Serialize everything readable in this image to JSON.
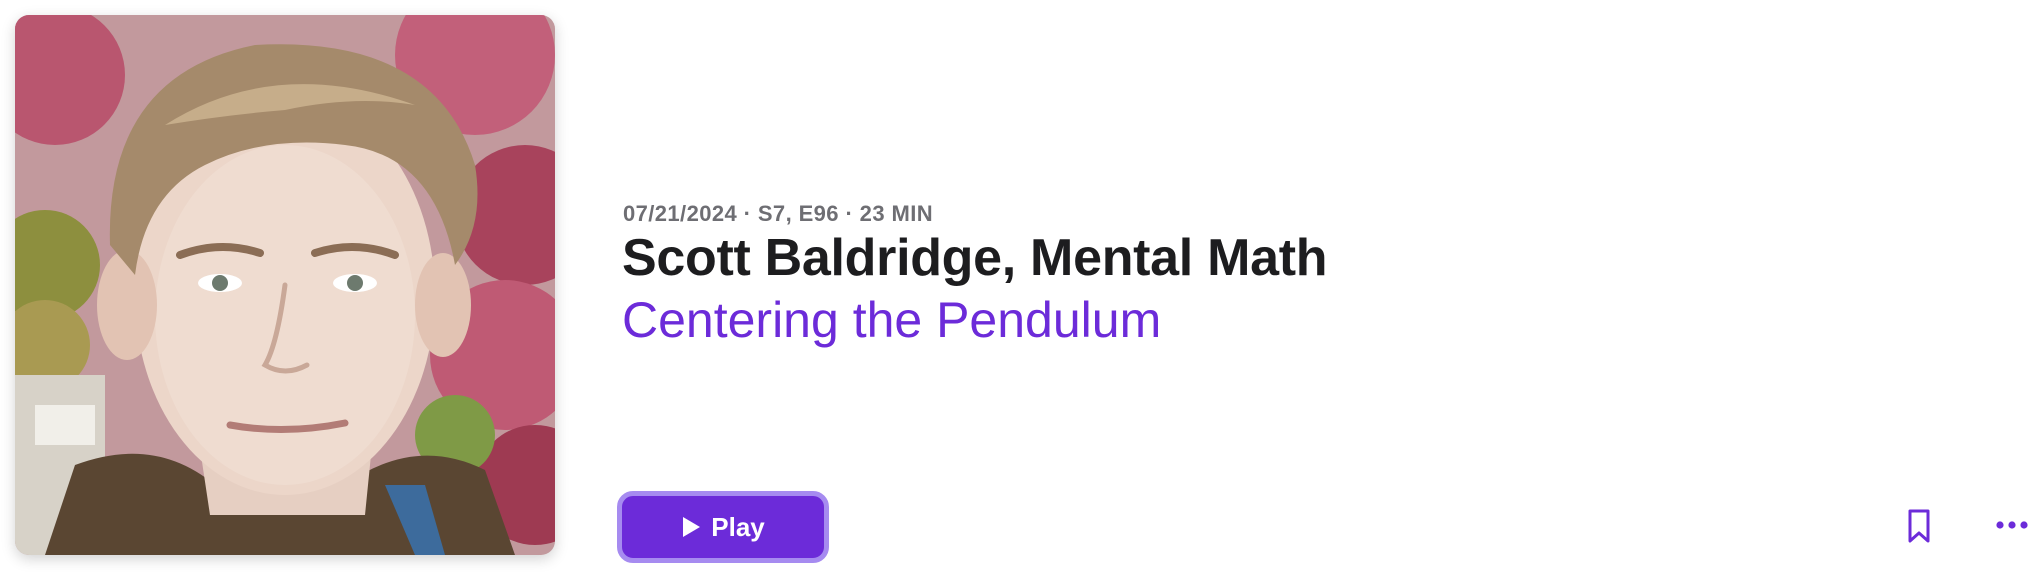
{
  "episode": {
    "meta": "07/21/2024 · S7, E96 · 23 MIN",
    "title": "Scott Baldridge, Mental Math",
    "show_name": "Centering the Pendulum",
    "artwork_icon": "episode-artwork-portrait"
  },
  "actions": {
    "play_label": "Play",
    "play_icon": "play-icon",
    "bookmark_icon": "bookmark-icon",
    "more_icon": "ellipsis-icon"
  },
  "colors": {
    "accent": "#6c2bd9",
    "accent_ring": "#a68bf0",
    "title_text": "#1d1d1f",
    "meta_text": "#6e6e73",
    "background": "#ffffff"
  }
}
